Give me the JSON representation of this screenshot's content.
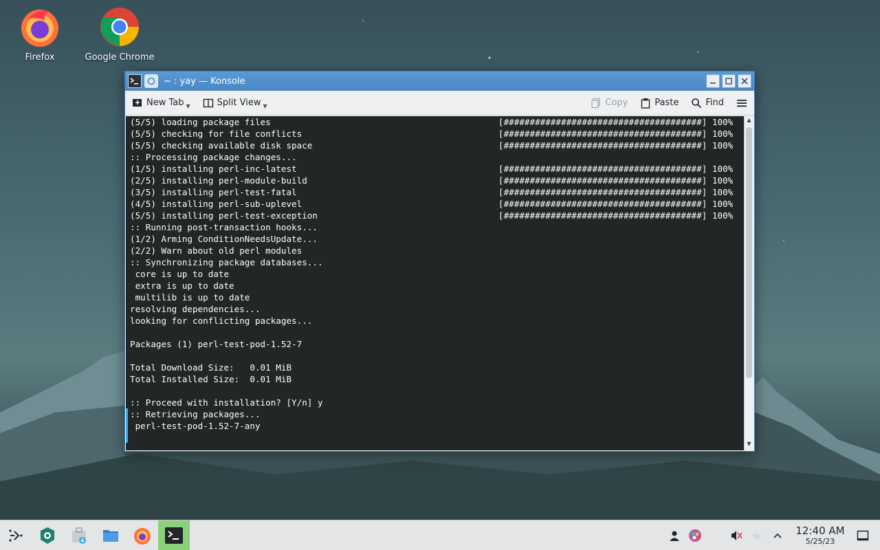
{
  "desktop": {
    "icons": [
      {
        "label": "Firefox",
        "icon": "firefox-icon"
      },
      {
        "label": "Google Chrome",
        "icon": "chrome-icon"
      }
    ]
  },
  "window": {
    "title": "~ : yay — Konsole",
    "toolbar": {
      "new_tab": "New Tab",
      "split_view": "Split View",
      "copy": "Copy",
      "paste": "Paste",
      "find": "Find"
    }
  },
  "terminal": {
    "lines": [
      {
        "text": "(5/5) loading package files",
        "bar": "[######################################] 100%"
      },
      {
        "text": "(5/5) checking for file conflicts",
        "bar": "[######################################] 100%"
      },
      {
        "text": "(5/5) checking available disk space",
        "bar": "[######################################] 100%"
      },
      {
        "text": ":: Processing package changes...",
        "bar": ""
      },
      {
        "text": "(1/5) installing perl-inc-latest",
        "bar": "[######################################] 100%"
      },
      {
        "text": "(2/5) installing perl-module-build",
        "bar": "[######################################] 100%"
      },
      {
        "text": "(3/5) installing perl-test-fatal",
        "bar": "[######################################] 100%"
      },
      {
        "text": "(4/5) installing perl-sub-uplevel",
        "bar": "[######################################] 100%"
      },
      {
        "text": "(5/5) installing perl-test-exception",
        "bar": "[######################################] 100%"
      },
      {
        "text": ":: Running post-transaction hooks...",
        "bar": ""
      },
      {
        "text": "(1/2) Arming ConditionNeedsUpdate...",
        "bar": ""
      },
      {
        "text": "(2/2) Warn about old perl modules",
        "bar": ""
      },
      {
        "text": ":: Synchronizing package databases...",
        "bar": ""
      },
      {
        "text": " core is up to date",
        "bar": ""
      },
      {
        "text": " extra is up to date",
        "bar": ""
      },
      {
        "text": " multilib is up to date",
        "bar": ""
      },
      {
        "text": "resolving dependencies...",
        "bar": ""
      },
      {
        "text": "looking for conflicting packages...",
        "bar": ""
      },
      {
        "text": "",
        "bar": ""
      },
      {
        "text": "Packages (1) perl-test-pod-1.52-7",
        "bar": ""
      },
      {
        "text": "",
        "bar": ""
      },
      {
        "text": "Total Download Size:   0.01 MiB",
        "bar": ""
      },
      {
        "text": "Total Installed Size:  0.01 MiB",
        "bar": ""
      },
      {
        "text": "",
        "bar": ""
      },
      {
        "text": ":: Proceed with installation? [Y/n] y",
        "bar": ""
      },
      {
        "text": ":: Retrieving packages...",
        "bar": ""
      },
      {
        "text": " perl-test-pod-1.52-7-any",
        "bar": ""
      }
    ]
  },
  "taskbar": {
    "launchers": [
      "app-launcher-icon",
      "discover-icon",
      "store-icon",
      "files-icon",
      "firefox-icon",
      "konsole-icon"
    ],
    "clock": {
      "time": "12:40 AM",
      "date": "5/25/23"
    }
  }
}
